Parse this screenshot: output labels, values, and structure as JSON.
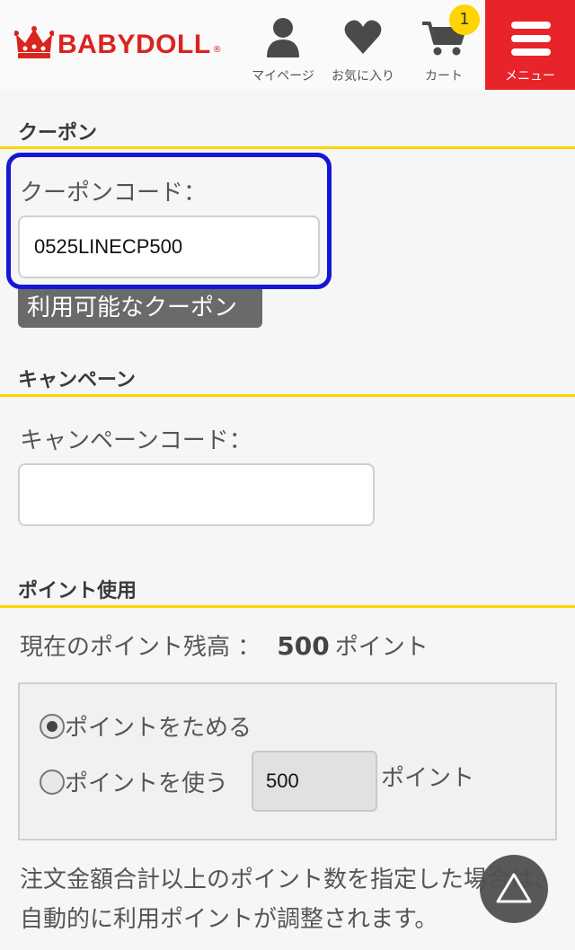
{
  "header": {
    "logo_text": "BABYDOLL",
    "logo_mark": "®",
    "nav": {
      "mypage_label": "マイページ",
      "favorites_label": "お気に入り",
      "cart_label": "カート",
      "cart_count": "1",
      "menu_label": "メニュー"
    },
    "colors": {
      "brand": "#d9241f",
      "menu_bg": "#e8232a",
      "badge": "#ffd400"
    }
  },
  "coupon": {
    "title": "クーポン",
    "field_label": "クーポンコード：",
    "value": "0525LINECP500",
    "available_button": "利用可能なクーポン"
  },
  "campaign": {
    "title": "キャンペーン",
    "field_label": "キャンペーンコード：",
    "value": ""
  },
  "points": {
    "title": "ポイント使用",
    "balance_label": "現在のポイント残高 ：",
    "balance_value": "500",
    "balance_unit": "ポイント",
    "option_save": "ポイントをためる",
    "option_use": "ポイントを使う",
    "use_value": "500",
    "use_unit": "ポイント",
    "selected": "save",
    "note": "注文金額合計以上のポイント数を指定した場合は、自動的に利用ポイントが調整されます。"
  },
  "accent_colors": {
    "rule": "#ffd400",
    "focus_outline": "#1616d6"
  },
  "icons": [
    "crown-icon",
    "person-icon",
    "heart-icon",
    "cart-icon",
    "hamburger-icon",
    "triangle-up-icon"
  ]
}
